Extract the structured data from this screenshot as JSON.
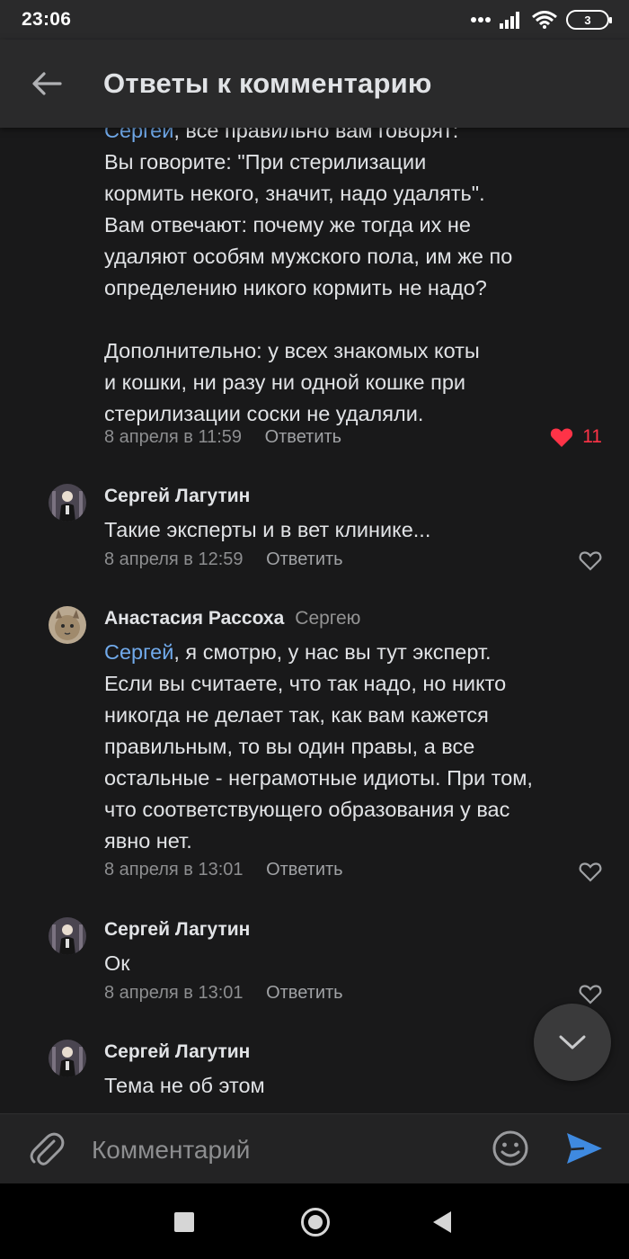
{
  "status_bar": {
    "time": "23:06",
    "battery": "3"
  },
  "header": {
    "title": "Ответы к комментарию"
  },
  "comments": [
    {
      "mention": "Сергей",
      "text_top_partial": ", все правильно вам говорят:",
      "lines": [
        "Вы говорите: \"При стерилизации",
        "кормить некого, значит, надо удалять\".",
        "Вам отвечают: почему же тогда их не",
        "удаляют особям мужского пола, им же по",
        "определению никого кормить не надо?",
        "",
        "Дополнительно: у всех знакомых коты",
        "и кошки, ни разу ни одной кошке при",
        "стерилизации соски не удаляли."
      ],
      "date": "8 апреля в 11:59",
      "reply": "Ответить",
      "likes": "11"
    },
    {
      "author": "Сергей Лагутин",
      "text": "Такие эксперты и в вет клинике...",
      "date": "8 апреля в 12:59",
      "reply": "Ответить"
    },
    {
      "author": "Анастасия Рассоха",
      "reply_to": "Сергею",
      "mention": "Сергей",
      "first_line_rest": ", я смотрю, у нас вы тут эксперт.",
      "lines": [
        "Если вы считаете, что так надо, но никто",
        "никогда не делает так, как вам кажется",
        "правильным, то вы один правы, а все",
        "остальные - неграмотные идиоты. При том,",
        "что соответствующего образования у вас",
        "явно нет."
      ],
      "date": "8 апреля в 13:01",
      "reply": "Ответить"
    },
    {
      "author": "Сергей Лагутин",
      "text": "Ок",
      "date": "8 апреля в 13:01",
      "reply": "Ответить"
    },
    {
      "author": "Сергей Лагутин",
      "text": "Тема не об этом"
    }
  ],
  "composer": {
    "placeholder": "Комментарий"
  },
  "colors": {
    "background": "#19191a",
    "header": "#2a2a2b",
    "mention": "#71aaeb",
    "like": "#ff3347",
    "send": "#3f8ae0"
  },
  "icons": {
    "back": "arrow-left-icon",
    "attach": "paperclip-icon",
    "emoji": "smile-icon",
    "send": "send-icon",
    "scroll_down": "chevron-down-icon",
    "like_filled": "heart-filled-icon",
    "like_empty": "heart-outline-icon"
  }
}
